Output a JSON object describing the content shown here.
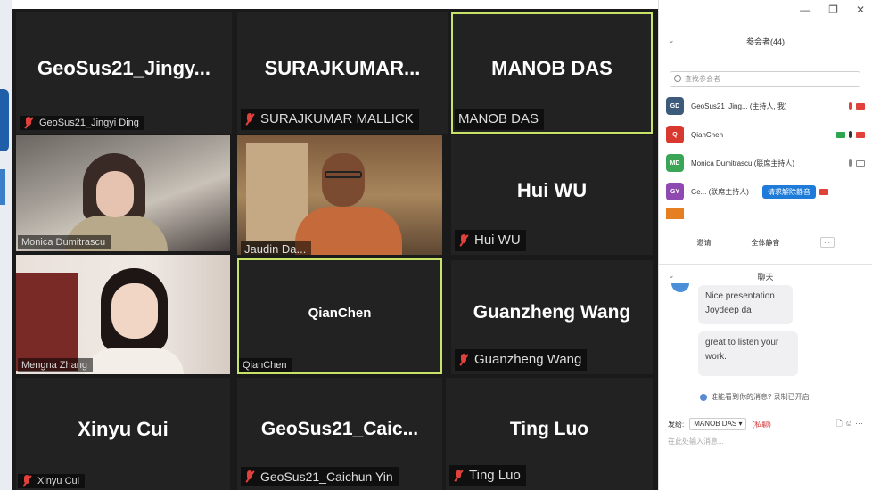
{
  "tiles": [
    {
      "id": "geosus-jingyi",
      "big_name": "GeoSus21_Jingy...",
      "label": "GeoSus21_Jingyi Ding",
      "muted": true
    },
    {
      "id": "surajkumar",
      "big_name": "SURAJKUMAR...",
      "label": "SURAJKUMAR MALLICK",
      "muted": true
    },
    {
      "id": "manob",
      "big_name": "MANOB DAS",
      "label": "MANOB DAS",
      "muted": false
    },
    {
      "id": "monica",
      "big_name": "",
      "label": "Monica Dumitrascu",
      "muted": false
    },
    {
      "id": "jaudin",
      "big_name": "",
      "label": "Jaudin Da...",
      "muted": false
    },
    {
      "id": "hui",
      "big_name": "Hui WU",
      "label": "Hui WU",
      "muted": true
    },
    {
      "id": "mengna",
      "big_name": "",
      "label": "Mengna Zhang",
      "muted": false
    },
    {
      "id": "qianchen",
      "big_name": "QianChen",
      "label": "QianChen",
      "muted": false
    },
    {
      "id": "guanzheng",
      "big_name": "Guanzheng Wang",
      "label": "Guanzheng Wang",
      "muted": true
    },
    {
      "id": "xinyu",
      "big_name": "Xinyu Cui",
      "label": "Xinyu Cui",
      "muted": true
    },
    {
      "id": "caichun",
      "big_name": "GeoSus21_Caic...",
      "label": "GeoSus21_Caichun Yin",
      "muted": true
    },
    {
      "id": "ting",
      "big_name": "Ting Luo",
      "label": "Ting Luo",
      "muted": true
    }
  ],
  "window": {
    "minimize": "—",
    "restore": "❐",
    "close": "✕"
  },
  "participants": {
    "collapse": "⌄",
    "title": "参会者(44)",
    "search_placeholder": "查找参会者",
    "rows": [
      {
        "initials": "GD",
        "color": "#3c5a7a",
        "name": "GeoSus21_Jing... (主持人, 我)"
      },
      {
        "initials": "Q",
        "color": "#d9382f",
        "name": "QianChen"
      },
      {
        "initials": "MD",
        "color": "#3aa655",
        "name": "Monica Dumitrascu (联席主持人)"
      },
      {
        "initials": "GY",
        "color": "#8e4ab0",
        "name": "Ge... (联席主持人)",
        "action": "请求解除静音"
      }
    ],
    "invite": "邀请",
    "mute_all": "全体静音",
    "more": "..."
  },
  "chat": {
    "collapse": "⌄",
    "title": "聊天",
    "messages": [
      {
        "text": "Nice presentation Joydeep da"
      },
      {
        "text": "great to listen your work."
      }
    ],
    "note": "谁能看到你的消息? 录制已开启",
    "to_label": "发给:",
    "recipient": "MANOB DAS ▾",
    "private": "(私聊)",
    "tools": "🗋 ☺ ···",
    "input_placeholder": "在此处输入消息..."
  }
}
